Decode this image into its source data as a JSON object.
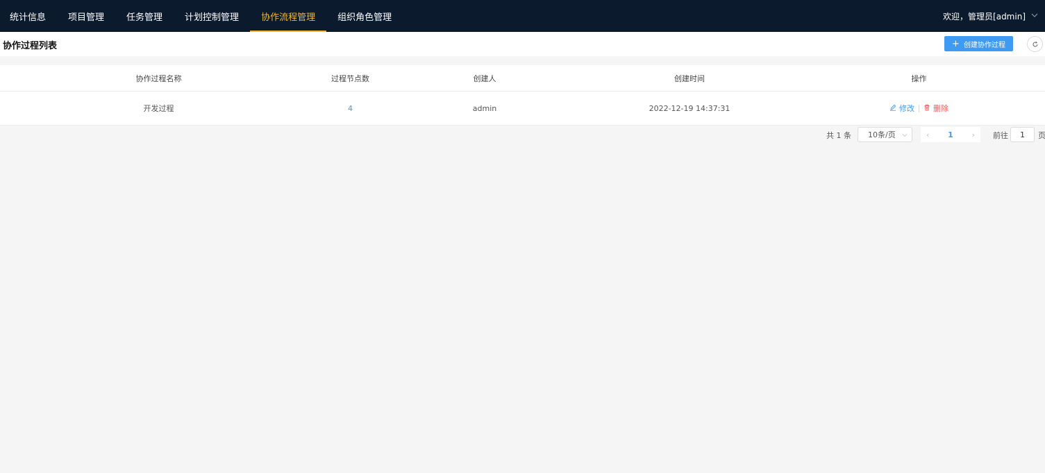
{
  "nav": {
    "items": [
      {
        "label": "统计信息"
      },
      {
        "label": "项目管理"
      },
      {
        "label": "任务管理"
      },
      {
        "label": "计划控制管理"
      },
      {
        "label": "协作流程管理"
      },
      {
        "label": "组织角色管理"
      }
    ],
    "active_index": 4,
    "user_label": "欢迎，管理员[admin]"
  },
  "header": {
    "title": "协作过程列表",
    "create_label": "创建协作过程"
  },
  "table": {
    "columns": [
      "协作过程名称",
      "过程节点数",
      "创建人",
      "创建时间",
      "操作"
    ],
    "rows": [
      {
        "name": "开发过程",
        "node_count": "4",
        "creator": "admin",
        "created_at": "2022-12-19 14:37:31",
        "edit_label": "修改",
        "delete_label": "删除"
      }
    ]
  },
  "pagination": {
    "total_label": "共 1 条",
    "page_size": "10条/页",
    "current_page": "1",
    "goto_label": "前往",
    "goto_value": "1",
    "page_unit": "页"
  },
  "colors": {
    "nav_bg": "#0b1a2c",
    "active": "#f2b72d",
    "primary": "#3e9bf1",
    "danger": "#f25c5c"
  }
}
